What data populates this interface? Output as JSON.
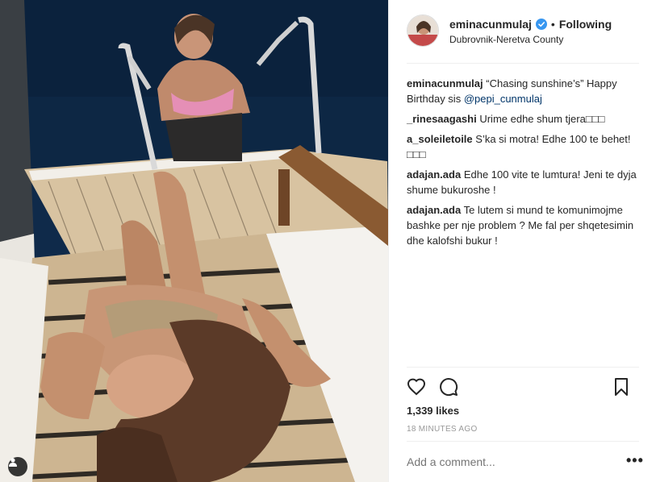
{
  "post": {
    "username": "eminacunmulaj",
    "follow_state": "Following",
    "separator": "•",
    "location": "Dubrovnik-Neretva County",
    "caption": {
      "author": "eminacunmulaj",
      "text": "“Chasing sunshine’s” Happy Birthday sis ",
      "mention": "@pepi_cunmulaj"
    },
    "comments": [
      {
        "author": "_rinesaagashi",
        "text": "Urime edhe shum tjera□□□"
      },
      {
        "author": "a_soleiletoile",
        "text": "S’ka si motra! Edhe 100 te behet! □□□"
      },
      {
        "author": "adajan.ada",
        "text": "Edhe 100 vite te lumtura! Jeni te dyja shume bukuroshe !"
      },
      {
        "author": "adajan.ada",
        "text": "Te lutem si mund te komunimojme bashke per nje problem ? Me fal per shqetesimin dhe kalofshi bukur !"
      }
    ],
    "likes": "1,339 likes",
    "time_ago": "18 MINUTES AGO",
    "add_comment_placeholder": "Add a comment...",
    "more_label": "•••"
  },
  "icons": {
    "verified": "verified-badge-icon",
    "heart": "heart-icon",
    "comment": "comment-icon",
    "bookmark": "bookmark-icon",
    "user_tag": "user-tag-icon",
    "more": "more-options-icon"
  },
  "colors": {
    "verified_blue": "#3897f0",
    "mention": "#003569",
    "muted_text": "#999999",
    "divider": "#efefef",
    "sea": "#0f2a4a",
    "deck_wood": "#d9c3a0",
    "handrail": "#8a5a32"
  }
}
